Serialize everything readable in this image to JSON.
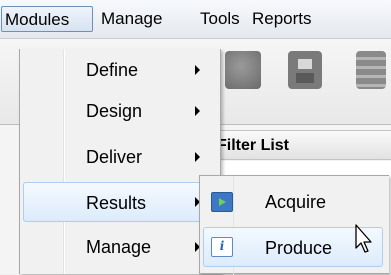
{
  "menubar": {
    "items": [
      "Modules",
      "Manage",
      "Tools",
      "Reports"
    ]
  },
  "background": {
    "panel_title": "Filter List",
    "toolbar_icons": [
      "module-icon",
      "save-icon",
      "stack-icon"
    ]
  },
  "modules_menu": {
    "items": [
      {
        "label": "Define",
        "has_submenu": true
      },
      {
        "label": "Design",
        "has_submenu": true
      },
      {
        "label": "Deliver",
        "has_submenu": true
      },
      {
        "label": "Results",
        "has_submenu": true,
        "highlighted": true
      },
      {
        "label": "Manage",
        "has_submenu": true
      }
    ]
  },
  "results_submenu": {
    "items": [
      {
        "label": "Acquire",
        "icon": "acquire-icon"
      },
      {
        "label": "Produce",
        "icon": "produce-icon",
        "highlighted": true,
        "icon_glyph": "i"
      }
    ]
  },
  "colors": {
    "highlight_border": "#aecdf0",
    "highlight_fill": "#dcebfc",
    "menu_background": "#f1f1f1"
  }
}
